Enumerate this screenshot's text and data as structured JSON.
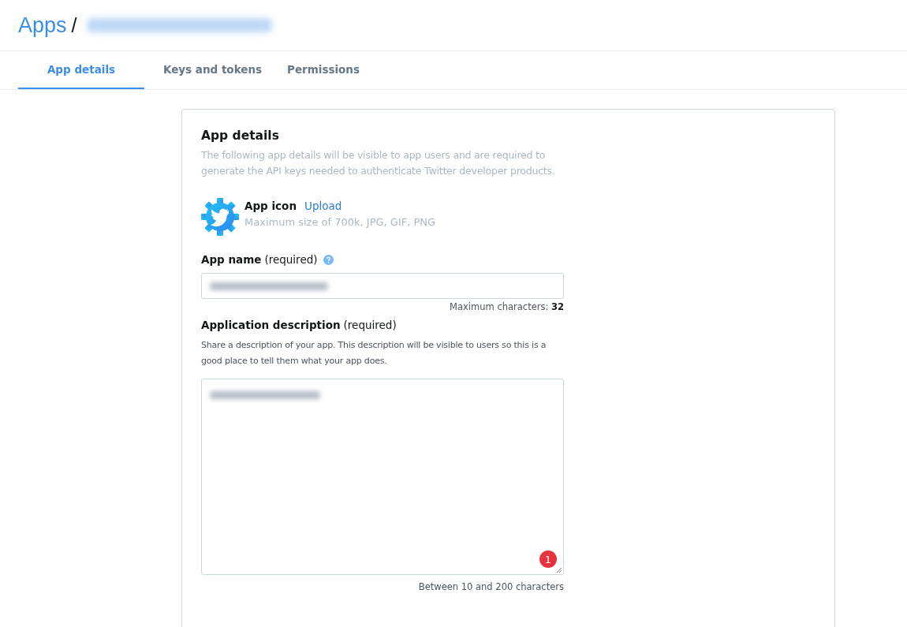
{
  "breadcrumb": {
    "root": "Apps",
    "separator": "/"
  },
  "tabs": [
    {
      "label": "App details",
      "selected": true
    },
    {
      "label": "Keys and tokens",
      "selected": false
    },
    {
      "label": "Permissions",
      "selected": false
    }
  ],
  "card": {
    "title": "App details",
    "intro": "The following app details will be visible to app users and are required to generate the API keys needed to authenticate Twitter developer products.",
    "app_icon": {
      "label": "App icon",
      "link": "Upload",
      "hint": "Maximum size of 700k, JPG, GIF, PNG"
    },
    "app_name": {
      "label": "App name",
      "note": "(required)",
      "max_label": "Maximum characters:",
      "max_value": "32"
    },
    "description": {
      "label": "Application description",
      "note": "(required)",
      "help": "Share a description of your app. This description will be visible to users so this is a good place to tell them what your app does.",
      "badge": "1",
      "limit": "Between 10 and 200 characters"
    }
  }
}
